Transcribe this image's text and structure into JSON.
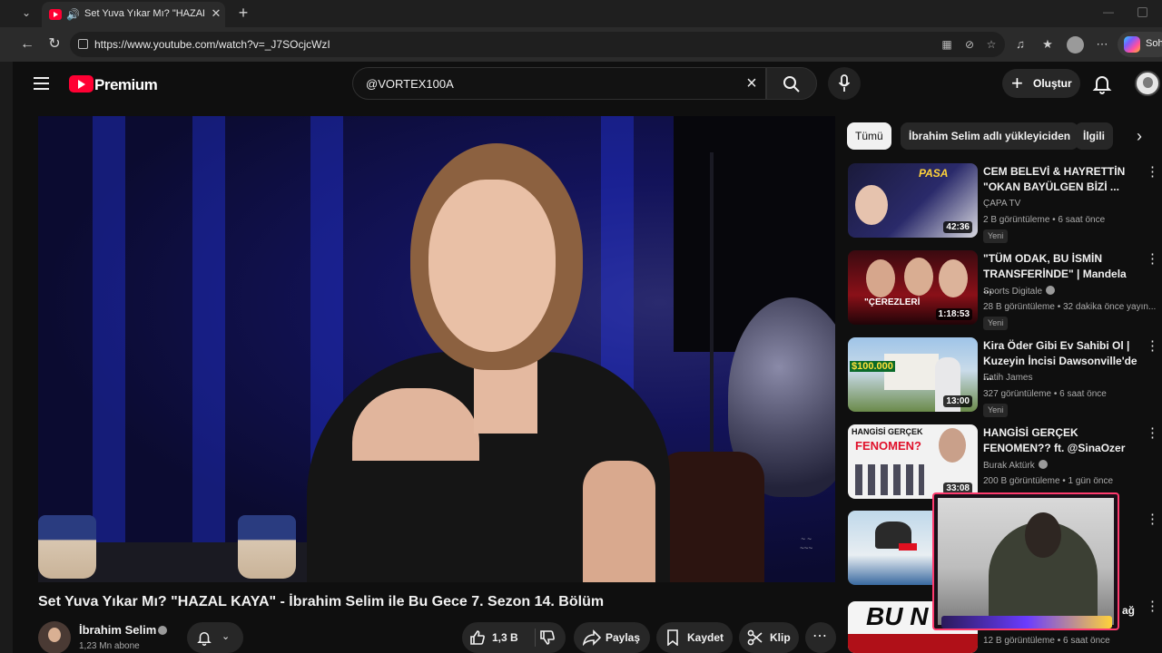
{
  "browser": {
    "tab_title": "Set Yuva Yıkar Mı? \"HAZAL KA",
    "url": "https://www.youtube.com/watch?v=_J7SOcjcWzI",
    "copilot_label": "Soh",
    "icons": [
      "back-icon",
      "refresh-icon",
      "lock-icon",
      "favorite-icon",
      "extensions-icon",
      "more-icon"
    ]
  },
  "header": {
    "logo_text": "Premium",
    "search_value": "@VORTEX100A",
    "create_label": "Oluştur"
  },
  "video": {
    "title": "Set Yuva Yıkar Mı? \"HAZAL KAYA\" - İbrahim Selim ile Bu Gece 7. Sezon 14. Bölüm",
    "channel_name": "İbrahim Selim",
    "subscribers": "1,23 Mn abone",
    "likes": "1,3 B",
    "share_label": "Paylaş",
    "save_label": "Kaydet",
    "clip_label": "Klip"
  },
  "chips": [
    "Tümü",
    "İbrahim Selim adlı yükleyiciden",
    "İlgili"
  ],
  "recommendations": [
    {
      "title": "CEM BELEVİ & HAYRETTİN \"OKAN BAYÜLGEN BİZİ ...",
      "channel": "ÇAPA TV",
      "meta": "2 B görüntüleme • 6 saat önce",
      "badge": "Yeni",
      "duration": "42:36",
      "verified": false,
      "thumb_text": "PASA"
    },
    {
      "title": "\"TÜM ODAK, BU İSMİN TRANSFERİNDE\" | Mandela ...",
      "channel": "Sports Digitale",
      "meta": "28 B görüntüleme • 32 dakika önce yayın...",
      "badge": "Yeni",
      "duration": "1:18:53",
      "verified": true,
      "thumb_text": "\"ÇEREZLERİ"
    },
    {
      "title": "Kira Öder Gibi Ev Sahibi Ol | Kuzeyin İncisi Dawsonville'de ...",
      "channel": "Fatih James",
      "meta": "327 görüntüleme • 6 saat önce",
      "badge": "Yeni",
      "duration": "13:00",
      "verified": false,
      "thumb_text": "$100.000"
    },
    {
      "title": "HANGİSİ GERÇEK FENOMEN?? ft. @SinaOzer",
      "channel": "Burak Aktürk",
      "meta": "200 B görüntüleme • 1 gün önce",
      "badge": "",
      "duration": "33:08",
      "verified": true,
      "thumb_text": "HANGİSİ GERÇEK"
    },
    {
      "title": "",
      "channel": "",
      "meta": "",
      "badge": "",
      "duration": "",
      "verified": false,
      "thumb_text": ""
    },
    {
      "title": "ağ",
      "channel": "",
      "meta": "12 B görüntüleme • 6 saat önce",
      "badge": "",
      "duration": "",
      "verified": false,
      "thumb_text": "BU N"
    }
  ],
  "colors": {
    "brand": "#ff0033",
    "background": "#0f0f0f",
    "chip": "#272727",
    "webcam_border": "#ff3b6e"
  }
}
